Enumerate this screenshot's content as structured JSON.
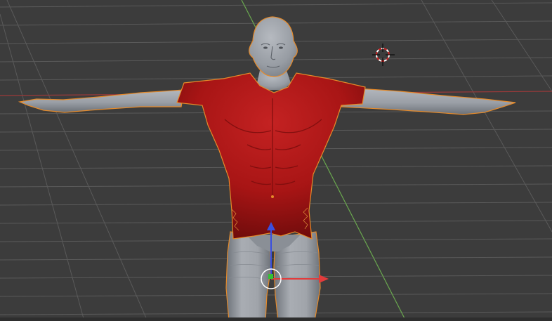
{
  "viewport": {
    "background": "#3c3c3c",
    "grid_color": "#5a5a5a",
    "x_axis_color": "#9b3a3a",
    "y_axis_color": "#6aa84f"
  },
  "model": {
    "skin_color": "#9ea3aa",
    "skin_shade": "#6f747b",
    "shirt_color": "#b01818",
    "shirt_shade": "#6e0c0c",
    "selection_outline": "#e58a2a"
  },
  "gizmo": {
    "x_arrow_color": "#e23b3b",
    "y_arrow_color": "#34c134",
    "z_arrow_color": "#3a4fe0",
    "ring_color": "#ffffff"
  },
  "cursor_3d": {
    "ring_primary": "#d22020",
    "ring_secondary": "#ffffff",
    "crosshair": "#000000"
  }
}
